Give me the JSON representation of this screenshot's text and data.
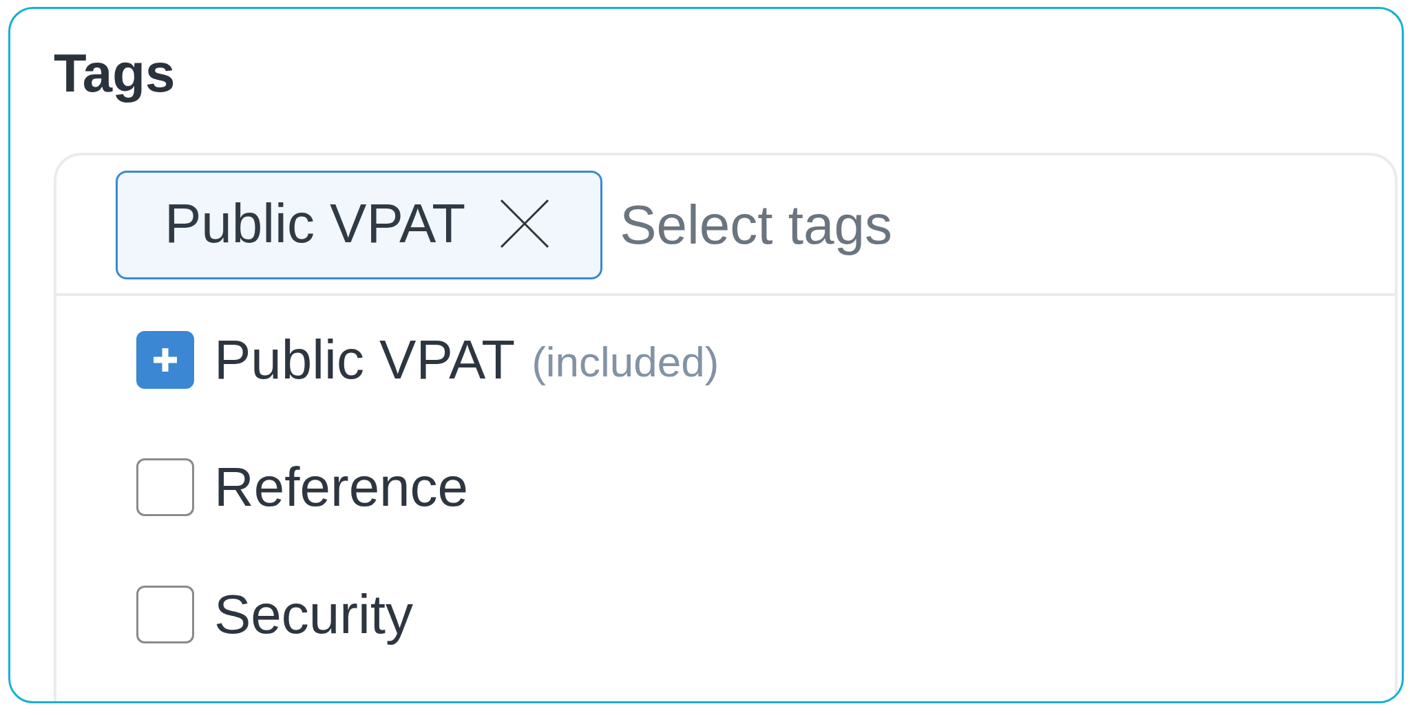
{
  "panel": {
    "title": "Tags"
  },
  "tag_select": {
    "chips": [
      {
        "label": "Public VPAT"
      }
    ],
    "placeholder": "Select tags",
    "options": [
      {
        "label": "Public VPAT",
        "note": "(included)",
        "checked": true
      },
      {
        "label": "Reference",
        "checked": false
      },
      {
        "label": "Security",
        "checked": false
      }
    ]
  }
}
